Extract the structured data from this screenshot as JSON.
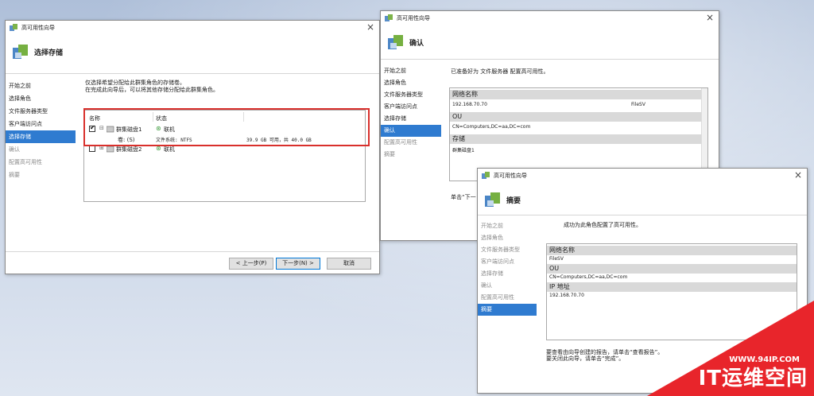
{
  "wizard1": {
    "title": "高可用性向导",
    "header": "选择存储",
    "nav": [
      "开始之前",
      "选择角色",
      "文件服务器类型",
      "客户端访问点",
      "选择存储",
      "确认",
      "配置高可用性",
      "摘要"
    ],
    "instructions": [
      "仅选择希望分配给此群集角色的存储卷。",
      "在完成此向导后，可以将其他存储分配给此群集角色。"
    ],
    "columns": [
      "名称",
      "状态"
    ],
    "disk1": {
      "name": "群集磁盘1",
      "status": "联机",
      "volume": "卷: (S)",
      "fs": "文件系统: NTFS",
      "capacity": "39.9 GB 可用，共 40.0 GB"
    },
    "disk2": {
      "name": "群集磁盘2",
      "status": "联机"
    },
    "buttons": {
      "prev": "< 上一步(P)",
      "next": "下一步(N) >",
      "cancel": "取消"
    }
  },
  "wizard2": {
    "title": "高可用性向导",
    "header": "确认",
    "nav": [
      "开始之前",
      "选择角色",
      "文件服务器类型",
      "客户端访问点",
      "选择存储",
      "确认",
      "配置高可用性",
      "摘要"
    ],
    "intro": "已准备好为 文件服务器 配置高可用性。",
    "sections": {
      "net_name": "网络名称",
      "ip": "192.168.70.70",
      "name": "FileSV",
      "ou": "OU",
      "ou_value": "CN=Computers,DC=aa,DC=com",
      "storage": "存储",
      "storage_value": "群集磁盘1"
    },
    "footer": "单击“下一"
  },
  "wizard3": {
    "title": "高可用性向导",
    "header": "摘要",
    "nav": [
      "开始之前",
      "选择角色",
      "文件服务器类型",
      "客户端访问点",
      "选择存储",
      "确认",
      "配置高可用性",
      "摘要"
    ],
    "intro": "成功为此角色配置了高可用性。",
    "sections": {
      "net_name": "网络名称",
      "name": "FileSV",
      "ou": "OU",
      "ou_value": "CN=Computers,DC=aa,DC=com",
      "ip_head": "IP 地址",
      "ip": "192.168.70.70"
    },
    "footer": [
      "要查看由向导创建的报告，请单击“查看报告”。",
      "要关闭此向导，请单击“完成”。"
    ]
  },
  "watermark": {
    "url": "WWW.94IP.COM",
    "brand": "IT运维空间"
  },
  "close_glyph": "×"
}
